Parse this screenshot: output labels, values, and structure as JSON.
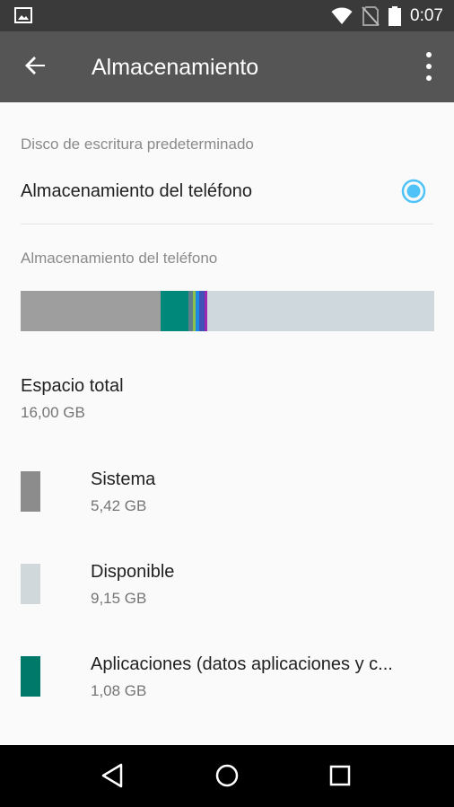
{
  "status_bar": {
    "time": "0:07",
    "icons": [
      "image-notification-icon",
      "wifi-icon",
      "no-sim-icon",
      "battery-icon"
    ]
  },
  "app_bar": {
    "title": "Almacenamiento",
    "back_icon": "arrow-back-icon",
    "menu_icon": "more-vert-icon"
  },
  "default_disk": {
    "header": "Disco de escritura predeterminado",
    "option_label": "Almacenamiento del teléfono",
    "selected": true
  },
  "phone_storage": {
    "header": "Almacenamiento del teléfono",
    "usage_bar": [
      {
        "name": "Sistema",
        "fraction": 0.339,
        "color": "#9e9e9e"
      },
      {
        "name": "Aplicaciones",
        "fraction": 0.0675,
        "color": "#00897b"
      },
      {
        "name": "segment-3",
        "fraction": 0.009,
        "color": "#607d8b"
      },
      {
        "name": "segment-4",
        "fraction": 0.008,
        "color": "#8bc34a"
      },
      {
        "name": "segment-5",
        "fraction": 0.009,
        "color": "#1e88e5"
      },
      {
        "name": "segment-6",
        "fraction": 0.012,
        "color": "#3f51b5"
      },
      {
        "name": "segment-7",
        "fraction": 0.006,
        "color": "#9c27b0"
      },
      {
        "name": "Disponible",
        "fraction": 0.5495,
        "color": "#cfd8dc"
      }
    ]
  },
  "total": {
    "label": "Espacio total",
    "value": "16,00 GB"
  },
  "legend": [
    {
      "label": "Sistema",
      "value": "5,42 GB",
      "color": "#8c8c8c"
    },
    {
      "label": "Disponible",
      "value": "9,15 GB",
      "color": "#d0d8dc"
    },
    {
      "label": "Aplicaciones (datos aplicaciones y c...",
      "value": "1,08 GB",
      "color": "#00796b"
    }
  ],
  "nav_bar": {
    "icons": [
      "back-triangle-icon",
      "home-circle-icon",
      "recents-square-icon"
    ]
  }
}
